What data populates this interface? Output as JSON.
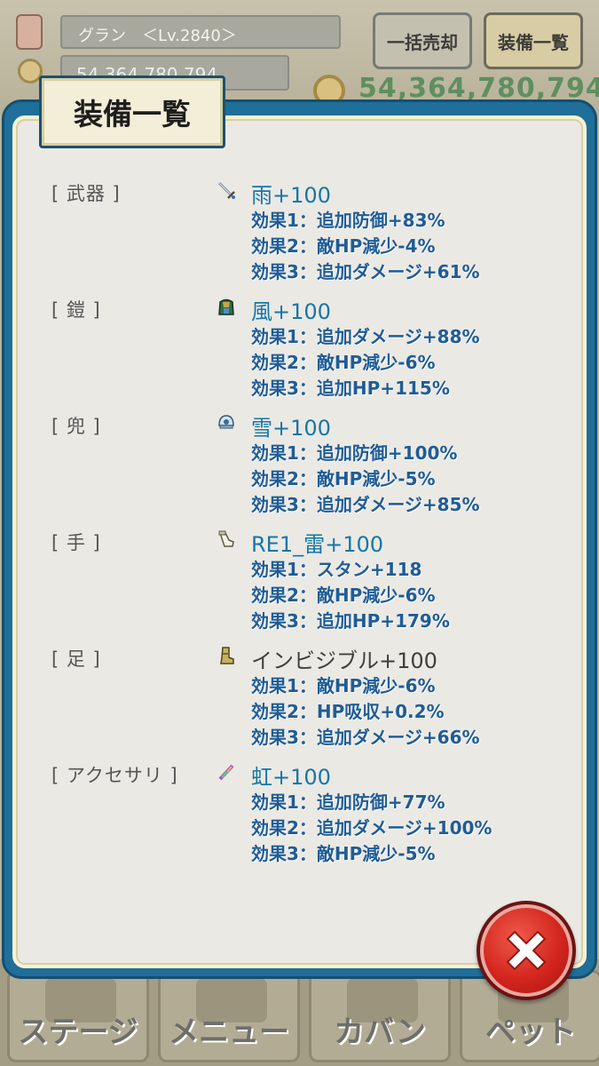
{
  "header": {
    "player_name": "グラン　＜Lv.2840＞",
    "gold_small": "54,364,780,794",
    "gold_big": "54,364,780,794",
    "sell_all_button": "一括売却",
    "equipment_list_button": "装備一覧"
  },
  "modal": {
    "title": "装備一覧",
    "slots": [
      {
        "label": "[ 武器 ]",
        "icon": "sword-icon",
        "item": "雨+100",
        "effects": [
          "効果1：追加防御+83%",
          "効果2：敵HP減少-4%",
          "効果3：追加ダメージ+61%"
        ]
      },
      {
        "label": "[ 鎧 ]",
        "icon": "armor-icon",
        "item": "風+100",
        "effects": [
          "効果1：追加ダメージ+88%",
          "効果2：敵HP減少-6%",
          "効果3：追加HP+115%"
        ]
      },
      {
        "label": "[ 兜 ]",
        "icon": "helmet-icon",
        "item": "雪+100",
        "effects": [
          "効果1：追加防御+100%",
          "効果2：敵HP減少-5%",
          "効果3：追加ダメージ+85%"
        ]
      },
      {
        "label": "[ 手 ]",
        "icon": "glove-icon",
        "item": "RE1_雷+100",
        "effects": [
          "効果1：スタン+118",
          "効果2：敵HP減少-6%",
          "効果3：追加HP+179%"
        ]
      },
      {
        "label": "[ 足 ]",
        "icon": "boot-icon",
        "item": "インビジブル+100",
        "effects": [
          "効果1：敵HP減少-6%",
          "効果2：HP吸収+0.2%",
          "効果3：追加ダメージ+66%"
        ]
      },
      {
        "label": "[ アクセサリ ]",
        "icon": "accessory-icon",
        "item": "虹+100",
        "effects": [
          "効果1：追加防御+77%",
          "効果2：追加ダメージ+100%",
          "効果3：敵HP減少-5%"
        ]
      }
    ]
  },
  "bottom_tabs": [
    "ステージ",
    "メニュー",
    "カバン",
    "ペット"
  ],
  "colors": {
    "panel_border": "#1f6f9a",
    "item_name": "#1577a8",
    "effect_text": "#1f5c96",
    "close_button": "#d4261f"
  }
}
